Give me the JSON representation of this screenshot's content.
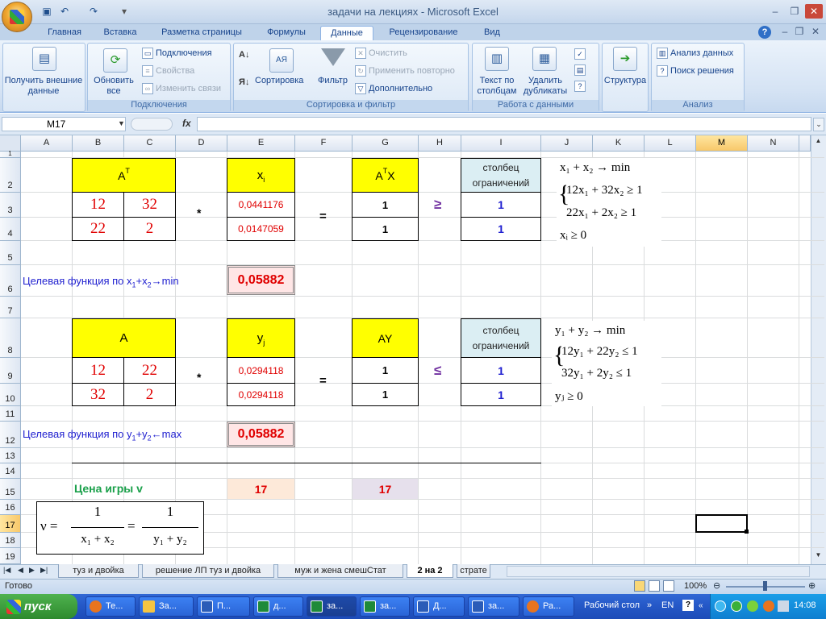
{
  "window": {
    "title": "задачи на лекциях - Microsoft Excel"
  },
  "tabs": [
    "Главная",
    "Вставка",
    "Разметка страницы",
    "Формулы",
    "Данные",
    "Рецензирование",
    "Вид"
  ],
  "ribbon": {
    "external": "Получить внешние данные",
    "refresh": "Обновить все",
    "connections": "Подключения",
    "properties": "Свойства",
    "edit_links": "Изменить связи",
    "sort": "Сортировка",
    "filter": "Фильтр",
    "clear": "Очистить",
    "reapply": "Применить повторно",
    "advanced": "Дополнительно",
    "text_to_cols": "Текст по столбцам",
    "remove_dup": "Удалить дубликаты",
    "outline": "Структура",
    "analysis": "Анализ данных",
    "solver": "Поиск решения",
    "g_connections": "Подключения",
    "g_sortfilter": "Сортировка и фильтр",
    "g_datatools": "Работа с данными",
    "g_analysis": "Анализ"
  },
  "formula_bar": {
    "name_box": "M17",
    "fx": "fx",
    "content": ""
  },
  "columns": [
    "A",
    "B",
    "C",
    "D",
    "E",
    "F",
    "G",
    "H",
    "I",
    "J",
    "K",
    "L",
    "M",
    "N"
  ],
  "rows": [
    "1",
    "2",
    "3",
    "4",
    "5",
    "6",
    "7",
    "8",
    "9",
    "10",
    "11",
    "12",
    "13",
    "14",
    "15",
    "16",
    "17",
    "18",
    "19"
  ],
  "sheet": {
    "at_label": "A",
    "at_sup": "T",
    "x_label": "x",
    "x_sub": "i",
    "atx_a": "A",
    "atx_sup": "T",
    "atx_x": "X",
    "constraints_hdr": "столбец ограничений",
    "m1": [
      "12",
      "32",
      "22",
      "2"
    ],
    "xi": [
      "0,0441176",
      "0,0147059"
    ],
    "atx": [
      "1",
      "1"
    ],
    "b1": [
      "1",
      "1"
    ],
    "mult": "*",
    "eq": "=",
    "ge": "≥",
    "le": "≤",
    "obj1_pre": "Целевая функция по x",
    "obj1_mid": "+x",
    "obj1_post": "→min",
    "obj1_value": "0,05882",
    "a_label": "A",
    "y_label": "y",
    "y_sub": "j",
    "ay_label": "AY",
    "m2": [
      "12",
      "22",
      "32",
      "2"
    ],
    "yj": [
      "0,0294118",
      "0,0294118"
    ],
    "ay": [
      "1",
      "1"
    ],
    "b2": [
      "1",
      "1"
    ],
    "obj2_pre": "Целевая функция по y",
    "obj2_mid": "+y",
    "obj2_post": "←max",
    "obj2_value": "0,05882",
    "price_label": "Цена игры v",
    "price1": "17",
    "price2": "17"
  },
  "formulas": {
    "f1_obj": "x₁ + x₂ → min",
    "f1_c1": "12x₁ + 32x₂ ≥ 1",
    "f1_c2": "22x₁ + 2x₂ ≥ 1",
    "f1_nn": "xᵢ ≥ 0",
    "f2_obj": "y₁ + y₂ → min",
    "f2_c1": "12y₁ + 22y₂ ≤ 1",
    "f2_c2": "32y₁ + 2y₂ ≤ 1",
    "f2_nn": "yⱼ ≥ 0",
    "nu": "ν =",
    "num": "1",
    "den1": "x₁ + x₂",
    "den2": "y₁ + y₂"
  },
  "sheet_tabs": [
    "туз и двойка",
    "решение ЛП туз и двойка",
    "муж и жена смешСтат",
    "2 на 2",
    "страте"
  ],
  "status": {
    "ready": "Готово",
    "zoom": "100%"
  },
  "taskbar": {
    "start": "пуск",
    "items": [
      "Те...",
      "За...",
      "П...",
      "д...",
      "за...",
      "за...",
      "Д...",
      "за...",
      "Ра..."
    ],
    "desktop": "Рабочий стол",
    "lang": "EN",
    "clock": "14:08"
  }
}
